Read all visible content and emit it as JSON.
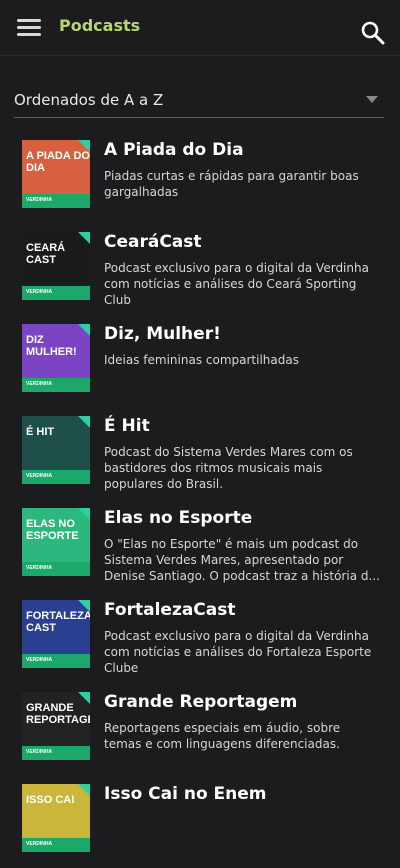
{
  "header": {
    "title": "Podcasts",
    "menu_icon": "hamburger-menu-icon",
    "search_icon": "search-icon",
    "accent": "#b6d672"
  },
  "sort": {
    "label": "Ordenados de A a Z"
  },
  "podcasts": [
    {
      "title": "A Piada do Dia",
      "description": "Piadas curtas e rápidas para garantir boas gargalhadas",
      "thumb_text": "A PIADA DO DIA",
      "thumb_color": "#d9603f"
    },
    {
      "title": "CearáCast",
      "description": "Podcast exclusivo para o digital da Verdinha com notícias e análises do Ceará Sporting Club",
      "thumb_text": "CEARÁ CAST",
      "thumb_color": "#1b1b1b"
    },
    {
      "title": "Diz, Mulher!",
      "description": "Ideias femininas compartilhadas",
      "thumb_text": "Diz mulher!",
      "thumb_color": "#7a44c4"
    },
    {
      "title": "É Hit",
      "description": "Podcast do Sistema Verdes Mares com os bastidores dos ritmos musicais mais populares do Brasil.",
      "thumb_text": "É HIT",
      "thumb_color": "#1f4f49"
    },
    {
      "title": "Elas no Esporte",
      "description": "O \"Elas no Esporte\" é mais um podcast do Sistema Verdes Mares, apresentado por Denise Santiago. O podcast traz a história d...",
      "thumb_text": "ELAS NO ESPORTE",
      "thumb_color": "#2bb87e"
    },
    {
      "title": "FortalezaCast",
      "description": "Podcast exclusivo para o digital da Verdinha com notícias e análises do Fortaleza Esporte Clube",
      "thumb_text": "FORTALEZA CAST",
      "thumb_color": "#2a3f8f"
    },
    {
      "title": "Grande Reportagem",
      "description": "Reportagens especiais em áudio, sobre temas e com linguagens diferenciadas.",
      "thumb_text": "GRANDE REPORTAGEM",
      "thumb_color": "#222222"
    },
    {
      "title": "Isso Cai no Enem",
      "description": "",
      "thumb_text": "ISSO CAI",
      "thumb_color": "#c9b63a"
    }
  ],
  "brand_label": "VERDINHA"
}
